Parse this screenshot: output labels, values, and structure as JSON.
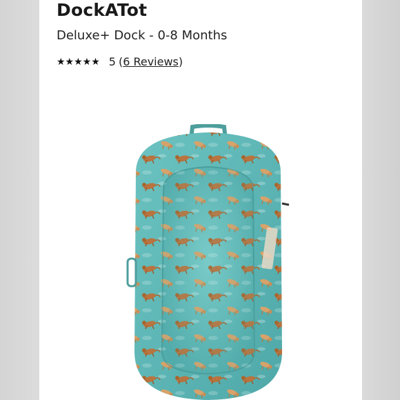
{
  "product": {
    "brand": "DockATot",
    "title": "Deluxe+ Dock - 0-8 Months",
    "rating": {
      "stars": "★★★★★",
      "value": "5",
      "open_paren": "(",
      "reviews_label": "6 Reviews",
      "close_paren": ")"
    },
    "image": {
      "icon": "baby-dock-photo",
      "fabric_color": "#5fb9b7",
      "animal_color": "#b9743f"
    }
  }
}
